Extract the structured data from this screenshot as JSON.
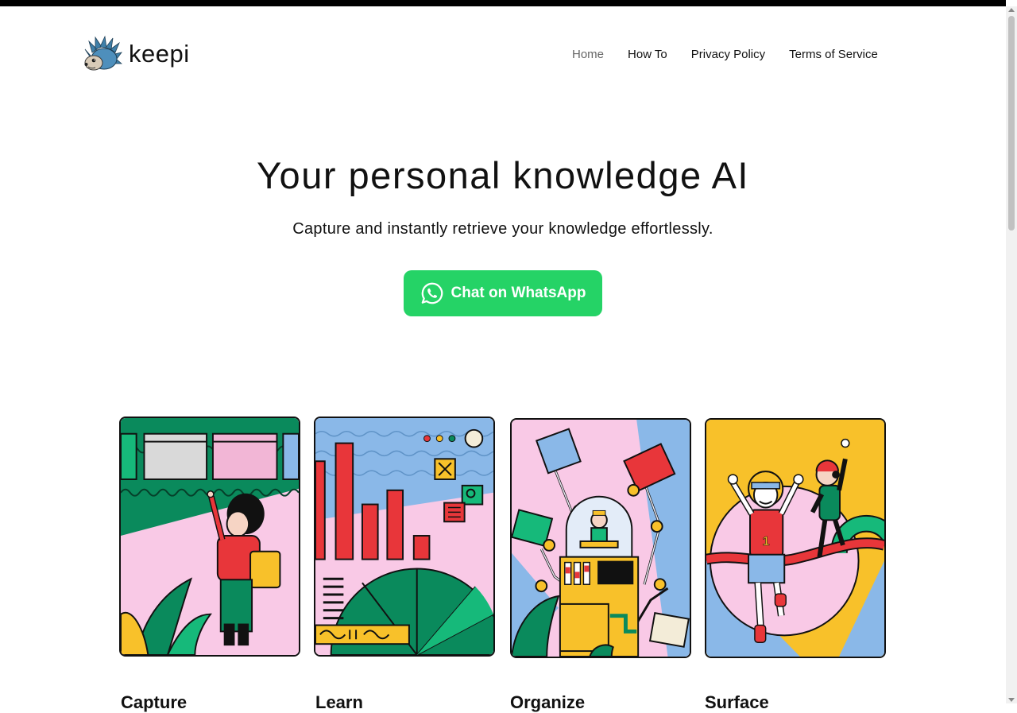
{
  "brand": {
    "name": "keepi"
  },
  "nav": {
    "items": [
      "Home",
      "How To",
      "Privacy Policy",
      "Terms of Service"
    ],
    "active": "Home"
  },
  "hero": {
    "title": "Your personal knowledge AI",
    "subtitle": "Capture and instantly retrieve your knowledge effortlessly.",
    "cta_label": "Chat on WhatsApp"
  },
  "features": [
    {
      "title": "Capture"
    },
    {
      "title": "Learn"
    },
    {
      "title": "Organize"
    },
    {
      "title": "Surface"
    }
  ],
  "colors": {
    "whatsapp_green": "#25d366",
    "card_green": "#0a8a5c",
    "card_pink": "#f9c9e6",
    "card_red": "#e8363a",
    "card_yellow": "#f8c12a",
    "card_blue": "#8ab8e8"
  },
  "icons": [
    "hedgehog-logo-icon",
    "whatsapp-icon"
  ]
}
